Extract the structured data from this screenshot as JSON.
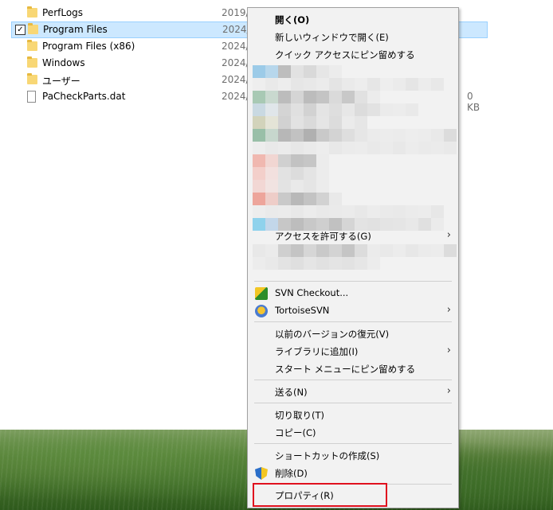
{
  "files": [
    {
      "name": "PerfLogs",
      "date": "2019/",
      "type": "folder",
      "size": ""
    },
    {
      "name": "Program Files",
      "date": "2024/",
      "type": "folder",
      "size": "",
      "selected": true
    },
    {
      "name": "Program Files (x86)",
      "date": "2024/",
      "type": "folder",
      "size": ""
    },
    {
      "name": "Windows",
      "date": "2024/",
      "type": "folder",
      "size": ""
    },
    {
      "name": "ユーザー",
      "date": "2024/",
      "type": "folder",
      "size": ""
    },
    {
      "name": "PaCheckParts.dat",
      "date": "2024/",
      "type": "file",
      "size": "0 KB"
    }
  ],
  "checkmark": "✓",
  "menu": {
    "open": "開く(O)",
    "open_new_window": "新しいウィンドウで開く(E)",
    "pin_quick_access": "クイック アクセスにピン留めする",
    "give_access": "アクセスを許可する(G)",
    "svn_checkout": "SVN Checkout...",
    "tortoise_svn": "TortoiseSVN",
    "restore_versions": "以前のバージョンの復元(V)",
    "add_to_library": "ライブラリに追加(I)",
    "pin_start": "スタート メニューにピン留めする",
    "send_to": "送る(N)",
    "cut": "切り取り(T)",
    "copy": "コピー(C)",
    "create_shortcut": "ショートカットの作成(S)",
    "delete": "削除(D)",
    "properties": "プロパティ(R)",
    "submenu_arrow": "›"
  },
  "icons": {
    "folder": "folder-icon",
    "file": "file-icon",
    "svn_checkout": "svn-checkout-icon",
    "tortoise_svn": "tortoisesvn-icon",
    "delete": "uac-shield-icon"
  },
  "colors": {
    "selection_bg": "#cce8ff",
    "menu_bg": "#f2f2f2",
    "highlight_border": "#e0101e"
  }
}
